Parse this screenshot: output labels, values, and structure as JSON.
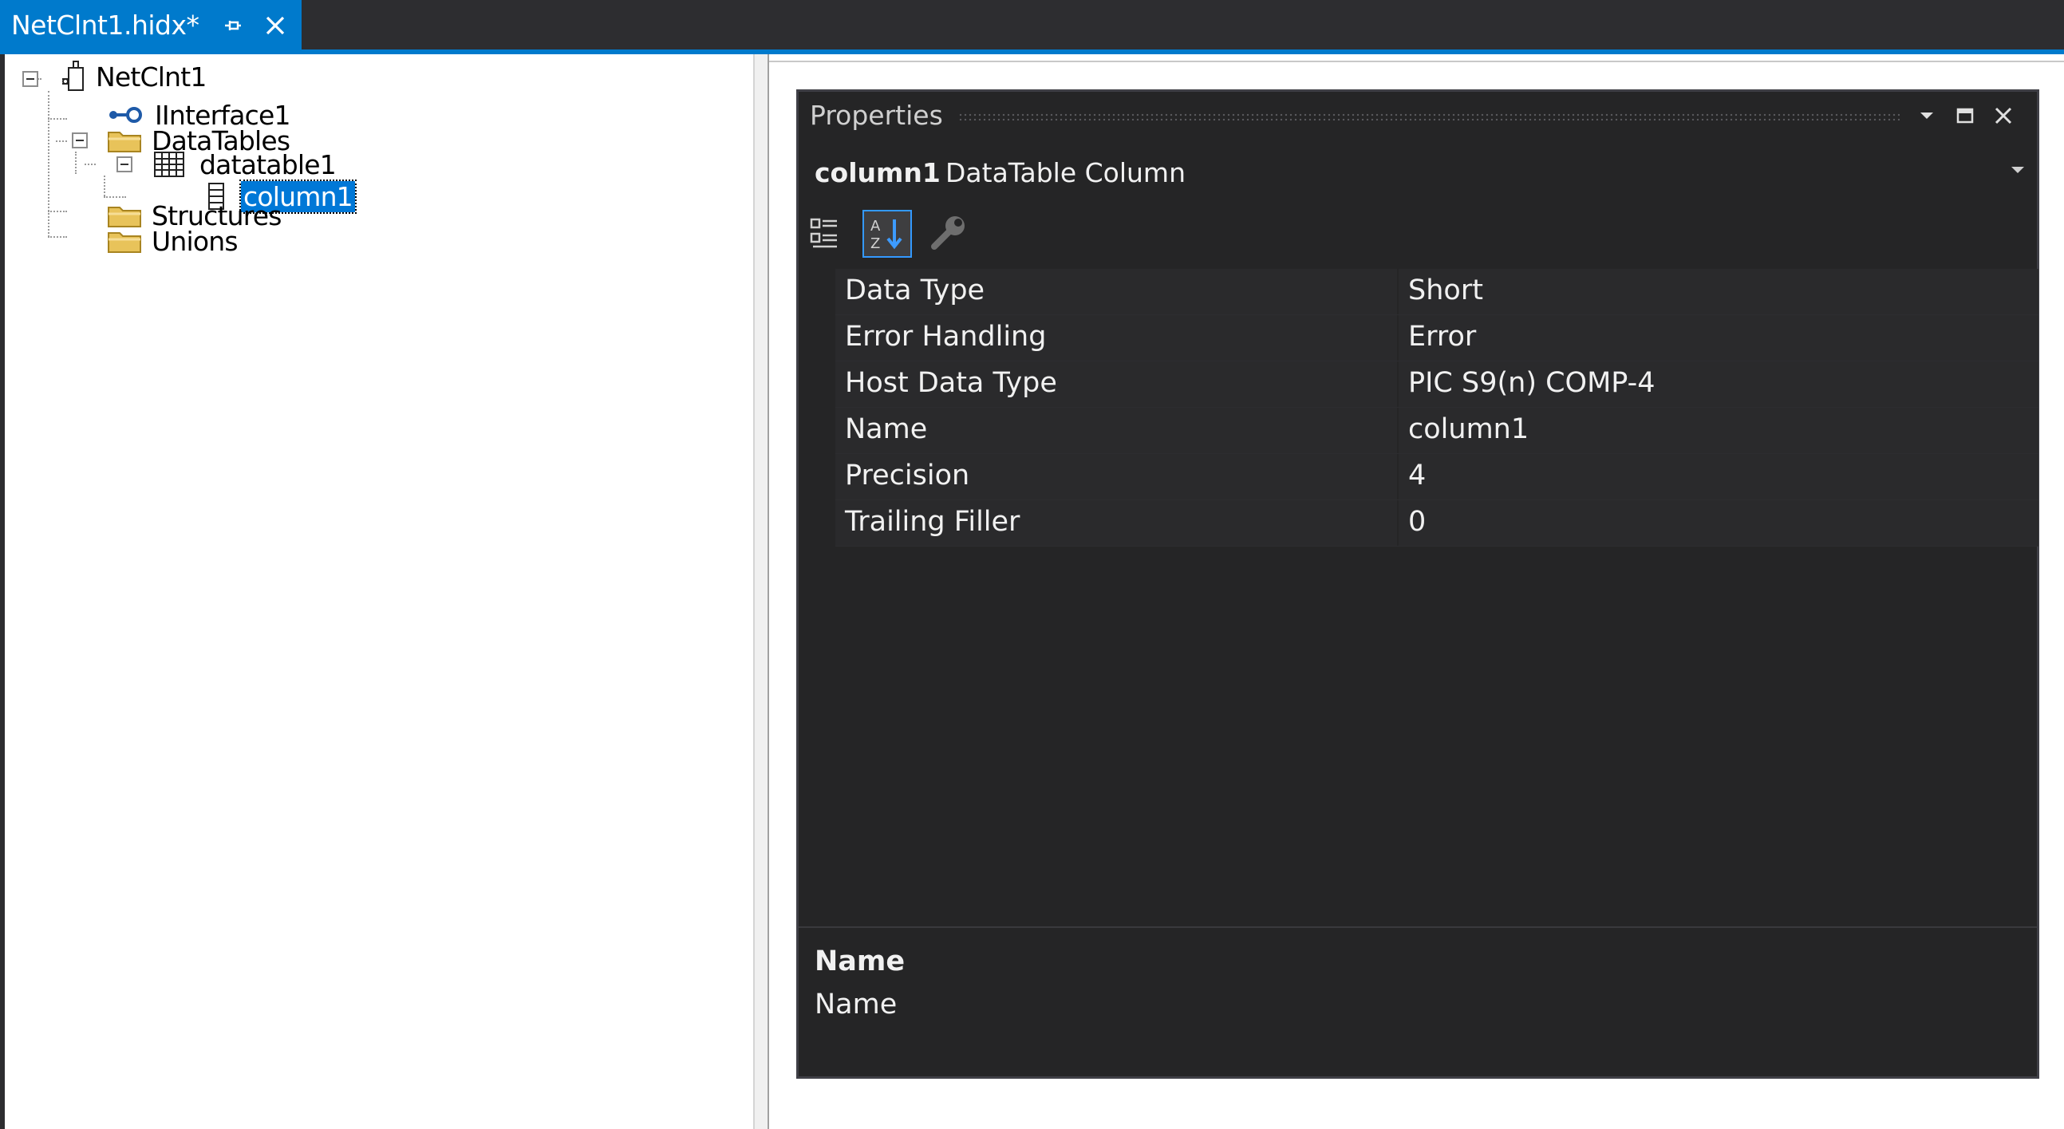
{
  "tab": {
    "title": "NetClnt1.hidx*",
    "pin_icon": "pin-icon",
    "close_icon": "close-icon"
  },
  "tree": {
    "root": {
      "label": "NetClnt1",
      "icon": "client-icon"
    },
    "items": [
      {
        "label": "IInterface1",
        "icon": "interface-icon"
      },
      {
        "label": "DataTables",
        "icon": "folder-icon"
      },
      {
        "label": "datatable1",
        "icon": "table-icon"
      },
      {
        "label": "column1",
        "icon": "column-icon",
        "selected": true
      },
      {
        "label": "Structures",
        "icon": "folder-icon"
      },
      {
        "label": "Unions",
        "icon": "folder-icon"
      }
    ]
  },
  "properties": {
    "title": "Properties",
    "object_name": "column1",
    "object_type": "DataTable Column",
    "rows": [
      {
        "name": "Data Type",
        "value": "Short"
      },
      {
        "name": "Error Handling",
        "value": "Error"
      },
      {
        "name": "Host Data Type",
        "value": "PIC S9(n) COMP-4"
      },
      {
        "name": "Name",
        "value": "column1"
      },
      {
        "name": "Precision",
        "value": "4"
      },
      {
        "name": "Trailing Filler",
        "value": "0"
      }
    ],
    "description_title": "Name",
    "description_text": "Name"
  },
  "colors": {
    "accent": "#007acc",
    "selection": "#0078d7",
    "panel_bg": "#252526",
    "folder": "#e8c35a"
  }
}
